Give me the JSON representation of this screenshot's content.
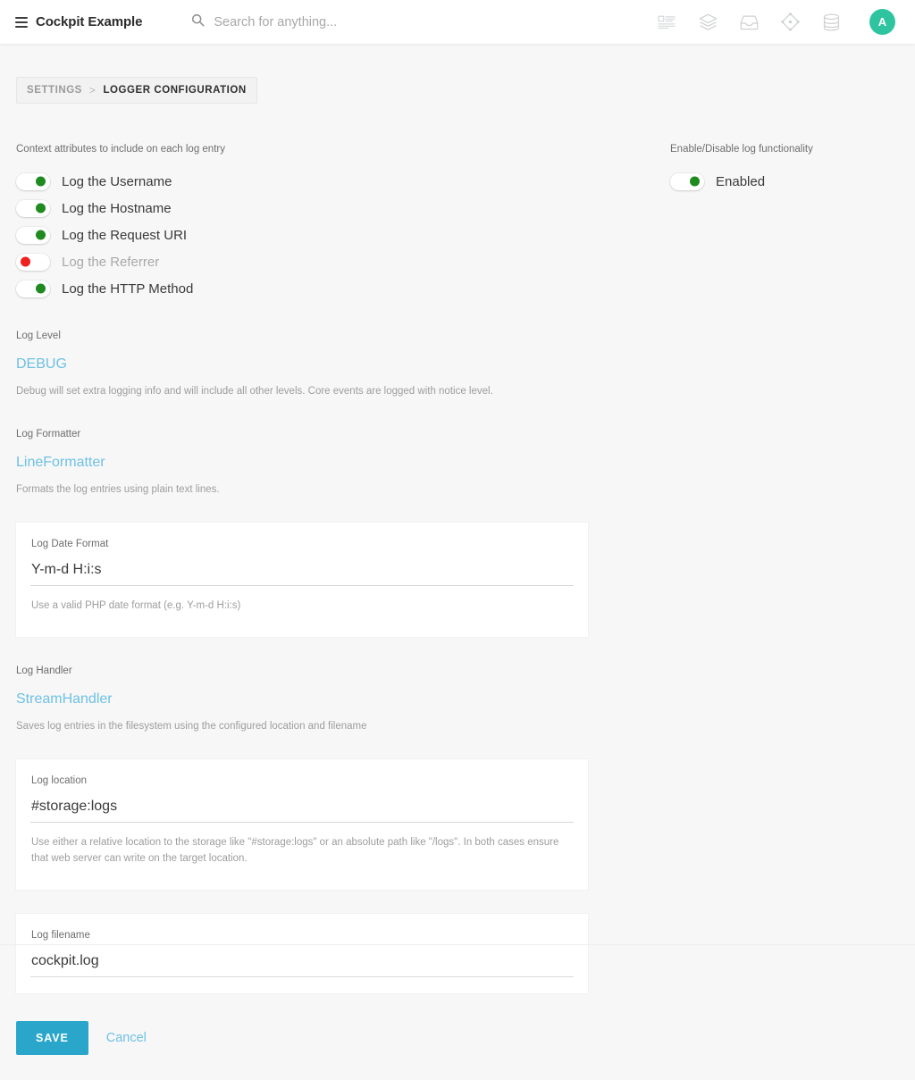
{
  "header": {
    "menu_icon": "hamburger-icon",
    "brand_title": "Cockpit Example",
    "search": {
      "icon": "search-icon",
      "value": "",
      "placeholder": "Search for anything..."
    },
    "icons": [
      {
        "name": "content-icon",
        "label": "Content"
      },
      {
        "name": "layers-icon",
        "label": "Collections"
      },
      {
        "name": "inbox-icon",
        "label": "Assets"
      },
      {
        "name": "node-icon",
        "label": "Singletons"
      },
      {
        "name": "database-icon",
        "label": "Database"
      }
    ],
    "avatar": {
      "initial": "A",
      "color": "#2ec4a0"
    }
  },
  "breadcrumb": {
    "parent": "SETTINGS",
    "separator": ">",
    "current": "LOGGER CONFIGURATION"
  },
  "context_section": {
    "label": "Context attributes to include on each log entry",
    "toggles": [
      {
        "label": "Log the Username",
        "state": "on",
        "state_color": "#1f8a1f"
      },
      {
        "label": "Log the Hostname",
        "state": "on",
        "state_color": "#1f8a1f"
      },
      {
        "label": "Log the Request URI",
        "state": "on",
        "state_color": "#1f8a1f"
      },
      {
        "label": "Log the Referrer",
        "state": "off",
        "state_color": "#f02020"
      },
      {
        "label": "Log the HTTP Method",
        "state": "on",
        "state_color": "#1f8a1f"
      }
    ]
  },
  "enable_section": {
    "label": "Enable/Disable log functionality",
    "toggle": {
      "label": "Enabled",
      "state": "on",
      "state_color": "#1f8a1f"
    }
  },
  "log_level": {
    "label": "Log Level",
    "value": "DEBUG",
    "help": "Debug will set extra logging info and will include all other levels. Core events are logged with notice level."
  },
  "log_formatter": {
    "label": "Log Formatter",
    "value": "LineFormatter",
    "help": "Formats the log entries using plain text lines."
  },
  "log_date_format": {
    "label": "Log Date Format",
    "value": "Y-m-d H:i:s",
    "placeholder": "",
    "help": "Use a valid PHP date format (e.g. Y-m-d H:i:s)"
  },
  "log_handler": {
    "label": "Log Handler",
    "value": "StreamHandler",
    "help": "Saves log entries in the filesystem using the configured location and filename"
  },
  "log_location": {
    "label": "Log location",
    "value": "#storage:logs",
    "placeholder": "",
    "help": "Use either a relative location to the storage like \"#storage:logs\" or an absolute path like \"/logs\". In both cases ensure that web server can write on the target location."
  },
  "log_filename": {
    "label": "Log filename",
    "value": "cockpit.log",
    "placeholder": "",
    "help": ""
  },
  "actions": {
    "save_label": "SAVE",
    "save_color": "#2ba6cb",
    "cancel_label": "Cancel",
    "cancel_color": "#6ec1e4"
  }
}
